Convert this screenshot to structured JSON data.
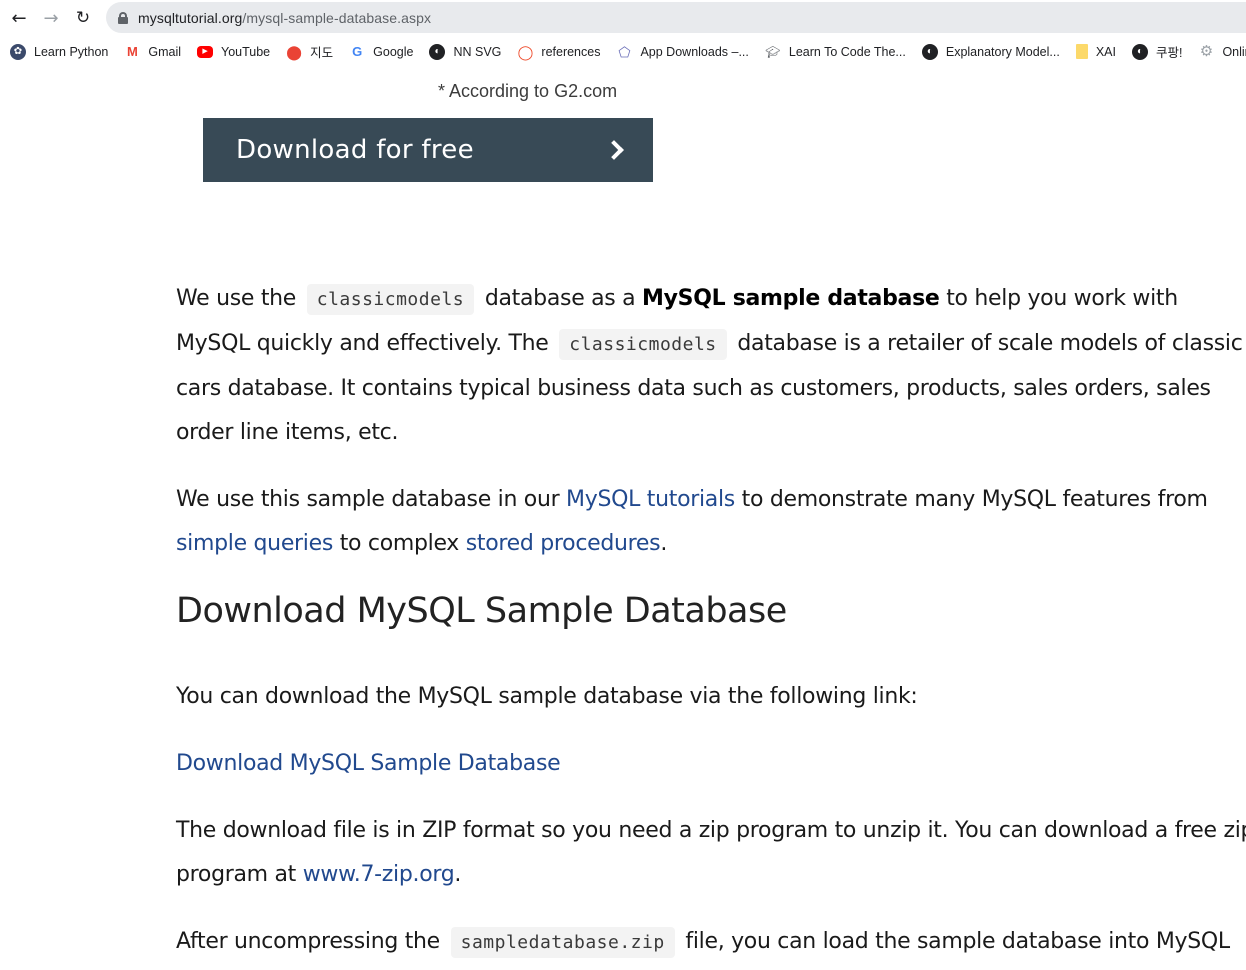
{
  "browser": {
    "url_domain": "mysqltutorial.org",
    "url_path": "/mysql-sample-database.aspx",
    "icons": {
      "back": "arrow-left-icon",
      "forward": "arrow-right-icon",
      "reload": "reload-icon",
      "lock": "lock-icon"
    },
    "bookmarks": [
      {
        "label": "Learn Python",
        "icon": "python-icon"
      },
      {
        "label": "Gmail",
        "icon": "gmail-icon"
      },
      {
        "label": "YouTube",
        "icon": "youtube-icon"
      },
      {
        "label": "지도",
        "icon": "maps-pin-icon"
      },
      {
        "label": "Google",
        "icon": "google-icon"
      },
      {
        "label": "NN SVG",
        "icon": "globe-icon"
      },
      {
        "label": "references",
        "icon": "pytorch-icon"
      },
      {
        "label": "App Downloads –...",
        "icon": "geogebra-icon"
      },
      {
        "label": "Learn To Code The...",
        "icon": "graduation-cap-icon"
      },
      {
        "label": "Explanatory Model...",
        "icon": "globe-icon"
      },
      {
        "label": "XAI",
        "icon": "folder-icon"
      },
      {
        "label": "쿠팡!",
        "icon": "globe-icon"
      },
      {
        "label": "Online",
        "icon": "gear-icon"
      }
    ]
  },
  "promo": {
    "note": "* According to G2.com",
    "button_label": "Download for free",
    "button_color": "#384a56"
  },
  "article": {
    "p1": {
      "t1": "We use the",
      "code1": "classicmodels",
      "t2": "database as a",
      "bold": "MySQL sample database",
      "t3": "to help you work with MySQL quickly and effectively. The",
      "code2": "classicmodels",
      "t4": "database is a retailer of scale models of classic cars database. It contains typical business data such as customers, products, sales orders, sales order line items, etc."
    },
    "p2": {
      "t1": "We use this sample database in our",
      "link1": "MySQL tutorials",
      "t2": "to demonstrate many MySQL features from",
      "link2": "simple queries",
      "t3": "to complex",
      "link3": "stored procedures",
      "t4": "."
    },
    "heading": "Download MySQL Sample Database",
    "p3": "You can download the MySQL sample database via the following link:",
    "download_link": "Download MySQL Sample Database",
    "p4": {
      "t1": "The download file is in ZIP format so you need a zip program to unzip it. You can download a free zip program at",
      "link": "www.7-zip.org",
      "t2": "."
    },
    "p5": {
      "t1": "After uncompressing the",
      "code": "sampledatabase.zip",
      "t2": "file, you can load the sample database into MySQL"
    },
    "link_color": "#21498e"
  }
}
